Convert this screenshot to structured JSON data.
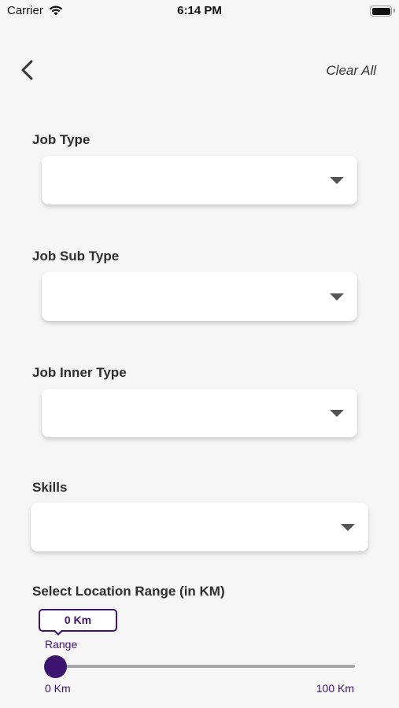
{
  "status_bar": {
    "carrier": "Carrier",
    "time": "6:14 PM",
    "battery_level": 1.0
  },
  "header": {
    "back_icon": "chevron-left-icon",
    "clear_all_label": "Clear All"
  },
  "filters": [
    {
      "label": "Job Type",
      "value": "",
      "icon": "caret-down-icon"
    },
    {
      "label": "Job Sub Type",
      "value": "",
      "icon": "caret-down-icon"
    },
    {
      "label": "Job Inner Type",
      "value": "",
      "icon": "caret-down-icon"
    },
    {
      "label": "Skills",
      "value": "",
      "icon": "caret-down-icon"
    }
  ],
  "location_range": {
    "title": "Select Location Range (in KM)",
    "current_value_text": "0 Km",
    "slider_label": "Range",
    "min_label": "0 Km",
    "max_label": "100 Km",
    "value": 0,
    "min": 0,
    "max": 100
  },
  "colors": {
    "accent": "#3d1470",
    "background": "#f6f6f6",
    "card": "#ffffff",
    "track": "#a8a8a8"
  }
}
